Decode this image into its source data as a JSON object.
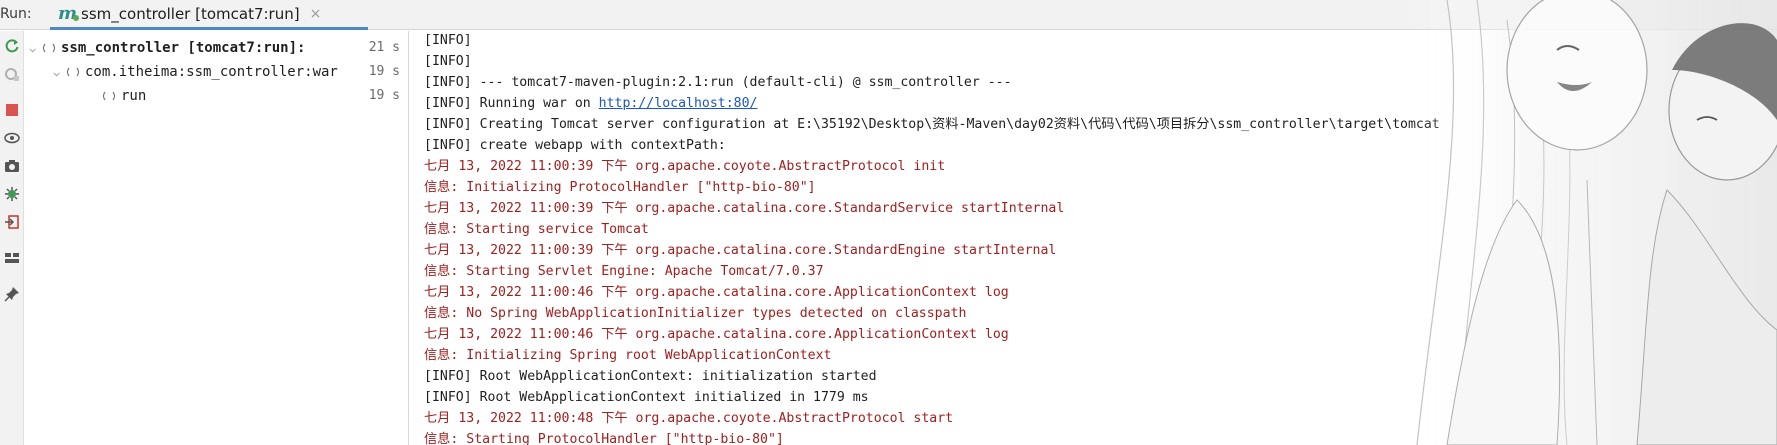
{
  "run_bar": {
    "label": "Run:",
    "tab_title": "ssm_controller [tomcat7:run]",
    "tab_icon": "maven-icon",
    "close_glyph": "×"
  },
  "toolbar": {
    "buttons": [
      "rerun-icon",
      "stop-rerun-icon",
      "stop-icon",
      "view-icon",
      "screenshot-icon",
      "settings-bug-icon",
      "exit-icon",
      "layout-icon",
      "pin-icon"
    ]
  },
  "tree": {
    "items": [
      {
        "label": "ssm_controller [tomcat7:run]:",
        "time": "21 s"
      },
      {
        "label": "com.itheima:ssm_controller:war",
        "time": "19 s"
      },
      {
        "label": "run",
        "time": "19 s"
      }
    ]
  },
  "console": {
    "lines": [
      {
        "type": "info",
        "text": "[INFO]"
      },
      {
        "type": "info",
        "text": "[INFO]"
      },
      {
        "type": "info",
        "text": "[INFO] --- tomcat7-maven-plugin:2.1:run (default-cli) @ ssm_controller ---"
      },
      {
        "type": "info",
        "text": "[INFO] Running war on ",
        "link": "http://localhost:80/"
      },
      {
        "type": "info",
        "text": "[INFO] Creating Tomcat server configuration at E:\\35192\\Desktop\\资料-Maven\\day02资料\\代码\\代码\\项目拆分\\ssm_controller\\target\\tomcat"
      },
      {
        "type": "info",
        "text": "[INFO] create webapp with contextPath:"
      },
      {
        "type": "err",
        "text": "七月 13, 2022 11:00:39 下午 org.apache.coyote.AbstractProtocol init"
      },
      {
        "type": "err",
        "text": "信息: Initializing ProtocolHandler [\"http-bio-80\"]"
      },
      {
        "type": "err",
        "text": "七月 13, 2022 11:00:39 下午 org.apache.catalina.core.StandardService startInternal"
      },
      {
        "type": "err",
        "text": "信息: Starting service Tomcat"
      },
      {
        "type": "err",
        "text": "七月 13, 2022 11:00:39 下午 org.apache.catalina.core.StandardEngine startInternal"
      },
      {
        "type": "err",
        "text": "信息: Starting Servlet Engine: Apache Tomcat/7.0.37"
      },
      {
        "type": "err",
        "text": "七月 13, 2022 11:00:46 下午 org.apache.catalina.core.ApplicationContext log"
      },
      {
        "type": "err",
        "text": "信息: No Spring WebApplicationInitializer types detected on classpath"
      },
      {
        "type": "err",
        "text": "七月 13, 2022 11:00:46 下午 org.apache.catalina.core.ApplicationContext log"
      },
      {
        "type": "err",
        "text": "信息: Initializing Spring root WebApplicationContext"
      },
      {
        "type": "info",
        "text": "[INFO] Root WebApplicationContext: initialization started"
      },
      {
        "type": "info",
        "text": "[INFO] Root WebApplicationContext initialized in 1779 ms"
      },
      {
        "type": "err",
        "text": "七月 13, 2022 11:00:48 下午 org.apache.coyote.AbstractProtocol start"
      },
      {
        "type": "err",
        "text": "信息: Starting ProtocolHandler [\"http-bio-80\"]"
      }
    ]
  },
  "colors": {
    "info_text": "#1f1f1f",
    "error_text": "#a11f1f",
    "link": "#1a56c4",
    "tab_underline": "#4a88c7"
  }
}
